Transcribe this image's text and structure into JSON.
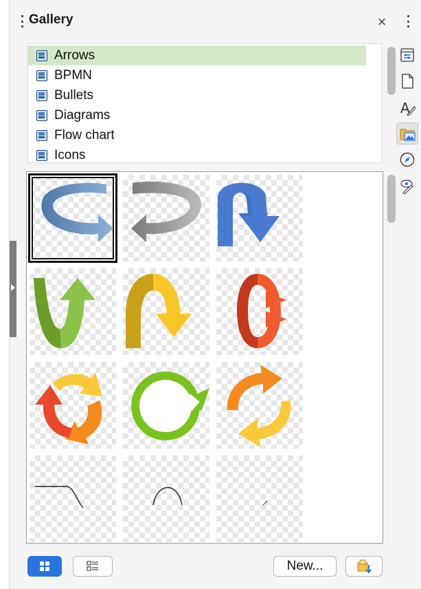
{
  "panel": {
    "title": "Gallery",
    "close_glyph": "×"
  },
  "themes": [
    {
      "label": "Arrows",
      "selected": true
    },
    {
      "label": "BPMN",
      "selected": false
    },
    {
      "label": "Bullets",
      "selected": false
    },
    {
      "label": "Diagrams",
      "selected": false
    },
    {
      "label": "Flow chart",
      "selected": false
    },
    {
      "label": "Icons",
      "selected": false
    }
  ],
  "gallery_items": [
    {
      "icon": "circular-arrow-blue-icon",
      "selected": true
    },
    {
      "icon": "circular-arrow-gray-icon",
      "selected": false
    },
    {
      "icon": "u-turn-arrow-blue-icon",
      "selected": false
    },
    {
      "icon": "u-arrow-green-icon",
      "selected": false
    },
    {
      "icon": "arch-arrow-yellow-icon",
      "selected": false
    },
    {
      "icon": "ring-arrow-red-icon",
      "selected": false
    },
    {
      "icon": "cycle-arrows-multicolor-icon",
      "selected": false
    },
    {
      "icon": "cycle-arrow-green-icon",
      "selected": false
    },
    {
      "icon": "cycle-arrows-orange-icon",
      "selected": false
    },
    {
      "icon": "line-curve-down-icon",
      "selected": false
    },
    {
      "icon": "line-arch-icon",
      "selected": false
    },
    {
      "icon": "line-curve-small-icon",
      "selected": false
    }
  ],
  "footer": {
    "icon_view_icon": "grid-view-icon",
    "detail_view_icon": "list-view-icon",
    "new_label": "New...",
    "properties_icon": "theme-properties-icon"
  },
  "sidebar_tabs": [
    {
      "icon": "properties-deck-icon",
      "active": false
    },
    {
      "icon": "page-deck-icon",
      "active": false
    },
    {
      "icon": "styles-deck-icon",
      "active": false
    },
    {
      "icon": "gallery-deck-icon",
      "active": true
    },
    {
      "icon": "navigator-deck-icon",
      "active": false
    },
    {
      "icon": "style-inspector-deck-icon",
      "active": false
    }
  ],
  "colors": {
    "selected_theme_bg": "#d3e8c8",
    "active_view_button": "#2a74e0"
  }
}
